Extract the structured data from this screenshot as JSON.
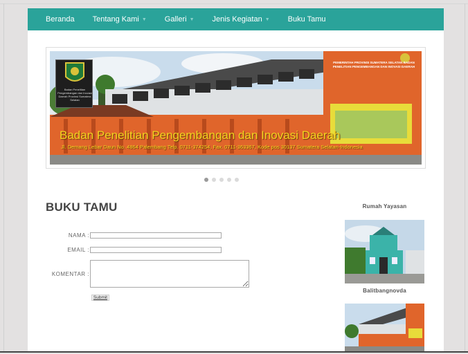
{
  "nav": {
    "items": [
      {
        "label": "Beranda",
        "dropdown": false
      },
      {
        "label": "Tentang Kami",
        "dropdown": true
      },
      {
        "label": "Galleri",
        "dropdown": true
      },
      {
        "label": "Jenis Kegiatan",
        "dropdown": true
      },
      {
        "label": "Buku Tamu",
        "dropdown": false
      }
    ],
    "caret_icon": "chevron-down-icon"
  },
  "slider": {
    "caption": "Badan Penelitian Pengembangan dan Inovasi Daerah",
    "subcaption": "Jl. Demang Lebar Daun No. 4864 Palembang Telp. 0711-374254, Fax. 0711-363367, Kode pos 30137 Sumatera Selatan-Indonesia",
    "logo_text": "Badan Penelitian Pengembangan dan Inovasi Daerah Provinsi Sumatera Selatan",
    "sign_text": "PEMERINTAH PROVINSI SUMATERA SELATAN BADAN PENELITIAN PENGEMBANGAN DAN INOVASI DAERAH",
    "dots": 5,
    "active_dot": 0
  },
  "page": {
    "title": "BUKU TAMU"
  },
  "form": {
    "name_label": "NAMA :",
    "email_label": "EMAIL :",
    "comment_label": "KOMENTAR :",
    "name_value": "",
    "email_value": "",
    "comment_value": "",
    "submit_label": "Submit"
  },
  "sidebar": {
    "widgets": [
      {
        "title": "Rumah Yayasan"
      },
      {
        "title": "Balitbangnovda"
      }
    ]
  },
  "colors": {
    "nav_bg": "#2aa39a",
    "caption": "#f5d21f",
    "building_orange": "#e0652b"
  }
}
